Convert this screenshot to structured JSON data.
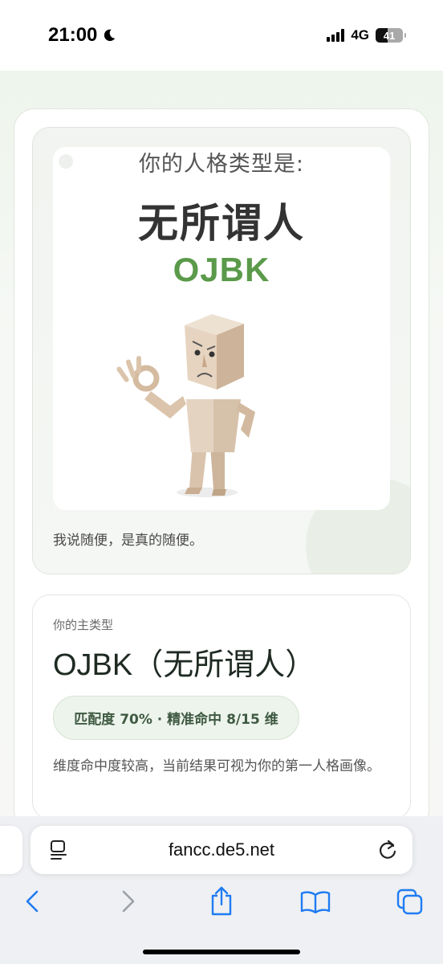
{
  "status_bar": {
    "time": "21:00",
    "network": "4G",
    "battery": "41"
  },
  "hero": {
    "heading": "你的人格类型是:",
    "name": "无所谓人",
    "code": "OJBK",
    "tagline": "我说随便，是真的随便。"
  },
  "main_type": {
    "eyebrow": "你的主类型",
    "title": "OJBK（无所谓人）",
    "match": "匹配度 70% · 精准命中 8/15 维",
    "description": "维度命中度较高，当前结果可视为你的第一人格画像。"
  },
  "browser": {
    "url": "fancc.de5.net"
  },
  "colors": {
    "accent_green": "#5a9a4a",
    "pill_bg": "#edf4ec"
  }
}
